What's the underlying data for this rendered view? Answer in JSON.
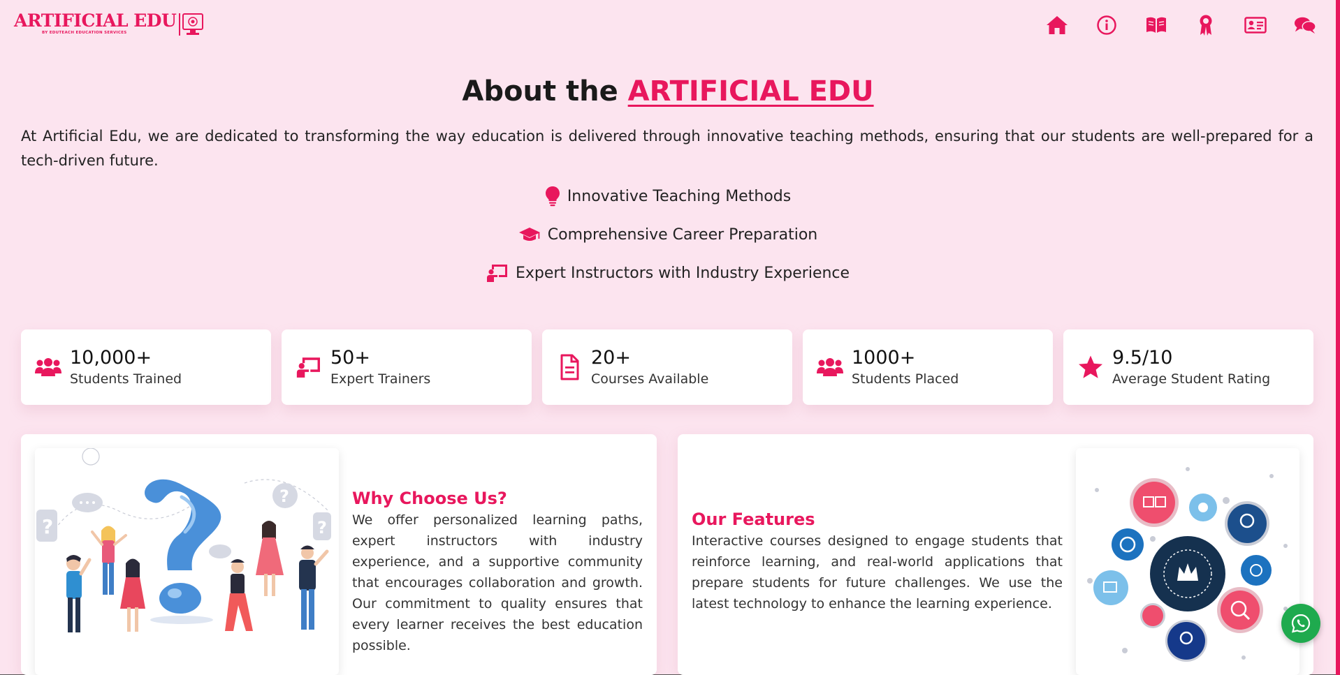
{
  "brand": {
    "name": "ARTIFICIAL EDU",
    "tagline": "BY EDUTEACH EDUCATION SERVICES"
  },
  "nav": [
    {
      "icon": "home-icon",
      "name": "nav-home"
    },
    {
      "icon": "info-icon",
      "name": "nav-about"
    },
    {
      "icon": "book-icon",
      "name": "nav-courses"
    },
    {
      "icon": "award-icon",
      "name": "nav-certifications"
    },
    {
      "icon": "contact-card-icon",
      "name": "nav-contact"
    },
    {
      "icon": "chat-icon",
      "name": "nav-chat"
    }
  ],
  "about": {
    "title_prefix": "About the",
    "title_brand": "ARTIFICIAL EDU",
    "description": "At Artificial Edu, we are dedicated to transforming the way education is delivered through innovative teaching methods, ensuring that our students are well-prepared for a tech-driven future.",
    "highlights": [
      {
        "icon": "lightbulb-icon",
        "label": "Innovative Teaching Methods"
      },
      {
        "icon": "graduation-cap-icon",
        "label": "Comprehensive Career Preparation"
      },
      {
        "icon": "teacher-board-icon",
        "label": "Expert Instructors with Industry Experience"
      }
    ]
  },
  "stats": [
    {
      "icon": "users-icon",
      "value": "10,000+",
      "label": "Students Trained"
    },
    {
      "icon": "teacher-board-icon",
      "value": "50+",
      "label": "Expert Trainers"
    },
    {
      "icon": "document-icon",
      "value": "20+",
      "label": "Courses Available"
    },
    {
      "icon": "users-icon",
      "value": "1000+",
      "label": "Students Placed"
    },
    {
      "icon": "star-icon",
      "value": "9.5/10",
      "label": "Average Student Rating"
    }
  ],
  "why": {
    "title": "Why Choose Us?",
    "text": "We offer personalized learning paths, expert instructors with industry experience, and a supportive community that encourages collaboration and growth. Our commitment to quality ensures that every learner receives the best education possible."
  },
  "features": {
    "title": "Our Features",
    "text": "Interactive courses designed to engage students that reinforce learning, and real-world applications that prepare students for future challenges. We use the latest technology to enhance the learning experience."
  },
  "colors": {
    "accent": "#e8175d",
    "background": "#fce4ef",
    "whatsapp": "#1faa4e"
  }
}
